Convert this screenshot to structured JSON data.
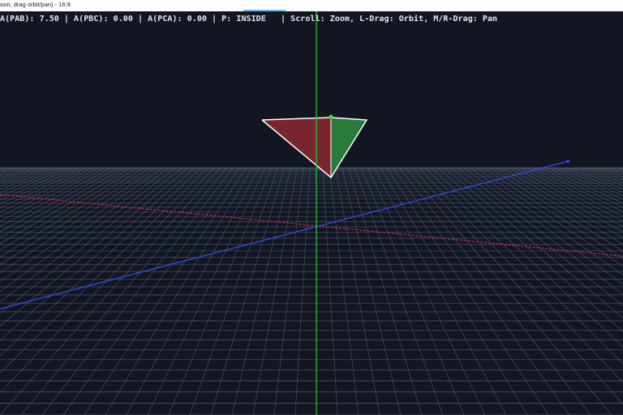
{
  "window": {
    "title": "oom, drag orbit/pan) - 16:9"
  },
  "hud": {
    "text": "A(PAB): 7.50 | A(PBC): 0.00 | A(PCA): 0.00 | P: INSIDE   | Scroll: Zoom, L-Drag: Orbit, M/R-Drag: Pan",
    "area_pab": 7.5,
    "area_pbc": 0.0,
    "area_pca": 0.0,
    "point_status": "INSIDE"
  },
  "colors": {
    "background": "#121622",
    "grid": "#5a6478",
    "axis_x": "#c0303a",
    "axis_y": "#22c03a",
    "axis_z": "#3050e0",
    "face_pab": "#7a262f",
    "face_pbc": "#2a7a3c",
    "edge": "#ffffff",
    "point": "#33dd44"
  },
  "icons": {
    "point_marker": "point-p-icon",
    "axis_endpoint": "axis-endpoint-icon"
  }
}
